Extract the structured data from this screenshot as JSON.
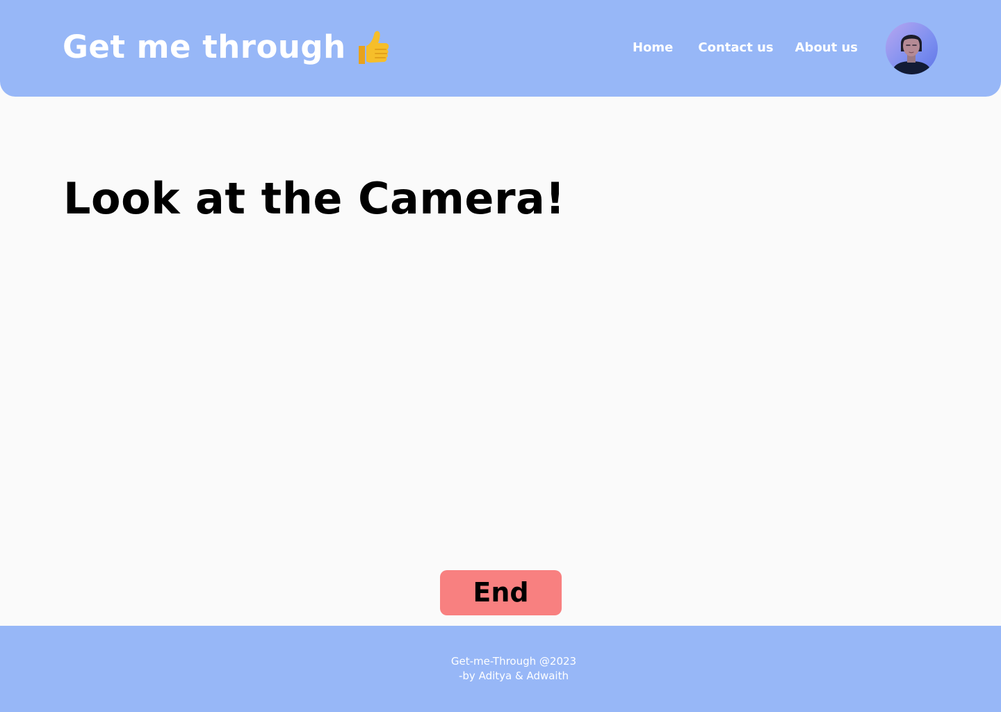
{
  "header": {
    "brand_title": "Get me through",
    "brand_icon": "thumbs-up-icon",
    "nav": {
      "home": "Home",
      "contact": "Contact us",
      "about": "About us"
    },
    "avatar_icon": "user-avatar"
  },
  "main": {
    "heading": "Look at the Camera!",
    "end_button": "End"
  },
  "footer": {
    "line1": "Get-me-Through @2023",
    "line2": "-by Aditya & Adwaith"
  },
  "colors": {
    "header_bg": "#97b7f7",
    "page_bg": "#fafafa",
    "end_button_bg": "#f88080",
    "text_light": "#ffffff",
    "text_dark": "#000000"
  }
}
